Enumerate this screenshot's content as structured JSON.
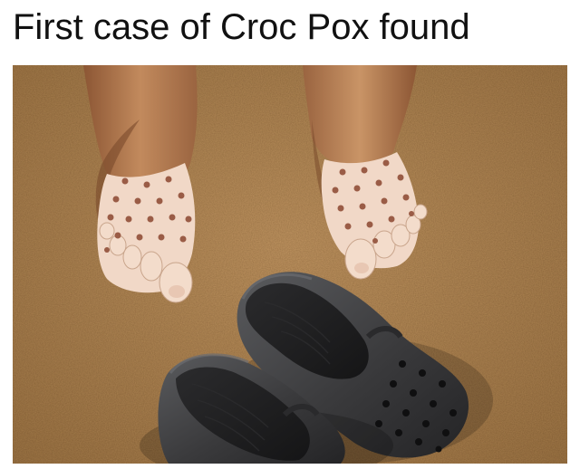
{
  "caption": "First case of Croc Pox found",
  "photo": {
    "subjects": [
      "left-foot",
      "right-foot",
      "left-croc-shoe",
      "right-croc-shoe"
    ],
    "colors": {
      "sand": "#b38a55",
      "sand_dark": "#8f6a3c",
      "tan_skin": "#b77a4e",
      "pale_skin": "#f1d8c7",
      "spot": "#9a5c46",
      "croc": "#3a3a3c",
      "croc_dark": "#1f1f21",
      "croc_light": "#5a5b5e"
    }
  }
}
